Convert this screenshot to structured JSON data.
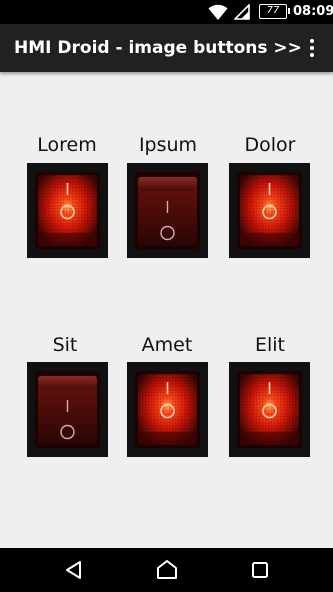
{
  "status_bar": {
    "battery_percent": "77",
    "time": "08:09",
    "icons": [
      "wifi-icon",
      "signal-icon",
      "battery-icon"
    ]
  },
  "action_bar": {
    "title": "HMI Droid - image buttons >>",
    "overflow_icon": "more-vert-icon"
  },
  "switches": [
    {
      "label": "Lorem",
      "state": "on"
    },
    {
      "label": "Ipsum",
      "state": "off"
    },
    {
      "label": "Dolor",
      "state": "on"
    },
    {
      "label": "Sit",
      "state": "off"
    },
    {
      "label": "Amet",
      "state": "on"
    },
    {
      "label": "Elit",
      "state": "on"
    }
  ],
  "nav_bar": {
    "icons": [
      "back-icon",
      "home-icon",
      "recents-icon"
    ]
  },
  "colors": {
    "status_bar": "#000000",
    "action_bar": "#212121",
    "background": "#efefef",
    "switch_on": "#ff2a12",
    "switch_off": "#5a0f0c"
  }
}
